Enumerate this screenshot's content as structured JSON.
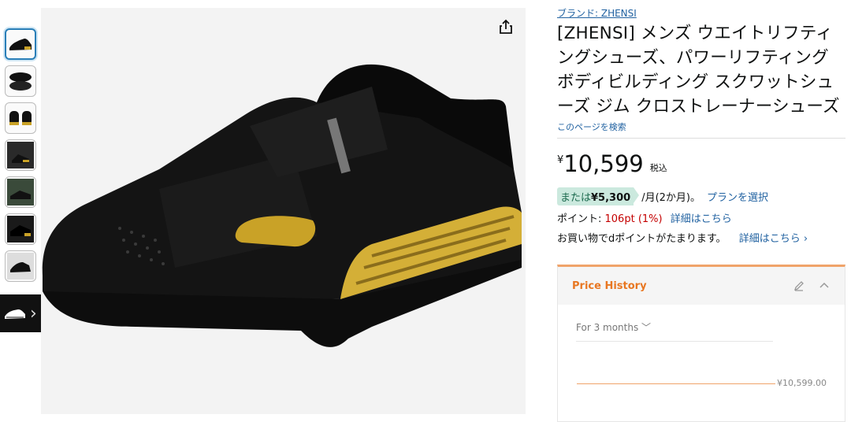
{
  "thumbnails": [
    "side-view",
    "top-view",
    "front-pair",
    "action-shot-1",
    "action-shot-2",
    "action-shot-3",
    "box-view"
  ],
  "more_images_icon": "chevron-right-icon",
  "share_icon": "share-icon",
  "product": {
    "brand_link": "ブランド: ZHENSI",
    "title": "[ZHENSI] メンズ ウエイトリフティングシューズ、パワーリフティングボディビルディング スクワットシューズ ジム クロストレーナーシューズ",
    "search_page": "このページを検索"
  },
  "price": {
    "currency": "¥",
    "amount": "10,599",
    "tax_note": "税込"
  },
  "plan": {
    "prefix": "または",
    "amount": "¥5,300",
    "suffix": "/月(2か月)。",
    "link": "プランを選択"
  },
  "points": {
    "label": "ポイント: ",
    "value": "106pt",
    "percent": "(1%)",
    "link": "詳細はこちら"
  },
  "dpoint": {
    "text": "お買い物でdポイントがたまります。",
    "link": "詳細はこちら ›"
  },
  "price_history": {
    "title": "Price History",
    "range": "For 3 months",
    "value": "¥10,599.00",
    "accent": "#e87722"
  }
}
